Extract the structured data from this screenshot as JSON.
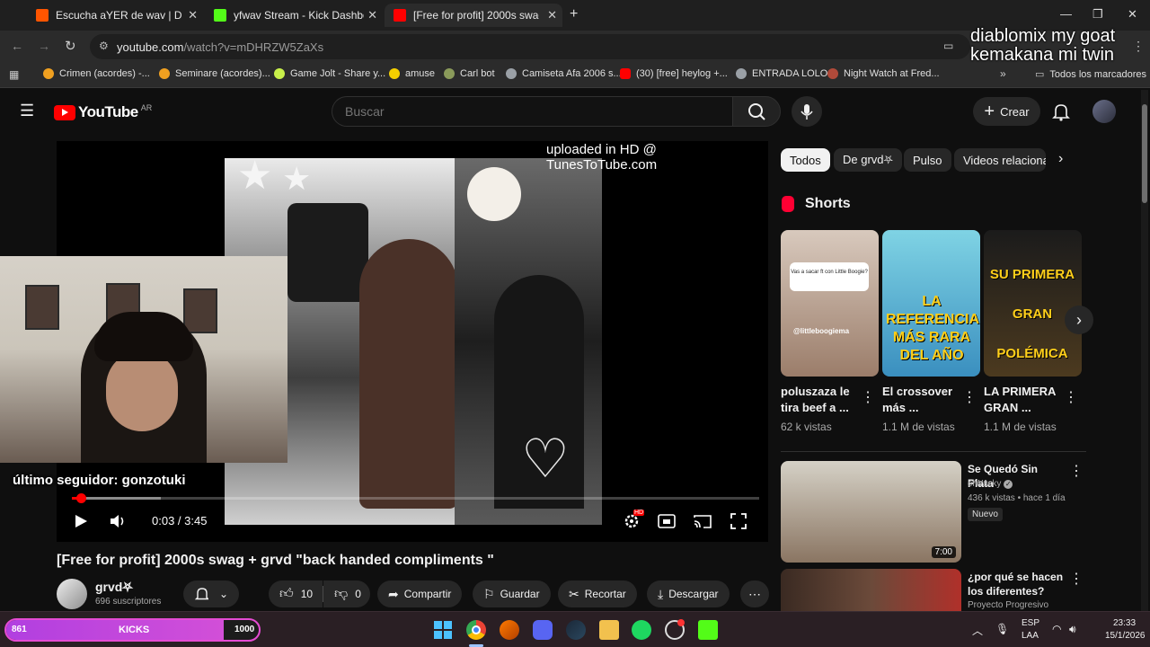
{
  "browser": {
    "tabs": [
      {
        "title": "Escucha aYER de wav | Disfruta",
        "color": "#ff5500"
      },
      {
        "title": "yfwav Stream - Kick Dashboard",
        "color": "#53fc18"
      },
      {
        "title": "[Free for profit] 2000s swag + g",
        "color": "#ff0000"
      }
    ],
    "url_host": "youtube.com",
    "url_path": "/watch?v=mDHRZW5ZaXs",
    "bookmarks": [
      "Crimen (acordes) -...",
      "Seminare (acordes)...",
      "Game Jolt - Share y...",
      "amuse",
      "Carl bot",
      "Camiseta Afa 2006 s...",
      "(30) [free] heylog +...",
      "ENTRADA LOLO",
      "Night Watch at Fred..."
    ],
    "all_bookmarks": "Todos los marcadores"
  },
  "overlay": {
    "line1": "diablomix my goat",
    "line2": "kemakana mi twin",
    "follower": "último seguidor: gonzotuki"
  },
  "youtube": {
    "logo": "YouTube",
    "region": "AR",
    "search_placeholder": "Buscar",
    "create_label": "Crear"
  },
  "player": {
    "watermark": "uploaded in HD @ TunesToTube.com",
    "current_time": "0:03",
    "duration": "3:45",
    "time_display": "0:03 / 3:45",
    "progress_fraction": 0.013,
    "buffer_fraction": 0.13
  },
  "video": {
    "title": "[Free for profit] 2000s swag + grvd \"back handed compliments \"",
    "channel": "grvd",
    "channel_suffix": "⛧",
    "subscribers": "696 suscriptores",
    "likes": "10",
    "dislikes": "0",
    "share_label": "Compartir",
    "save_label": "Guardar",
    "clip_label": "Recortar",
    "download_label": "Descargar"
  },
  "filters": [
    "Todos",
    "De grvd⛧",
    "Pulso",
    "Videos relaciona"
  ],
  "shorts": {
    "heading": "Shorts",
    "items": [
      {
        "title": "poluszaza le tira beef a ...",
        "views": "62 k vistas",
        "caption": "@littleboogiema",
        "question": "Vas a sacar ft con Little Boogie?"
      },
      {
        "title": "El crossover más ...",
        "views": "1.1 M de vistas",
        "caption": "LA REFERENCIA MÁS RARA DEL AÑO"
      },
      {
        "title": "LA PRIMERA GRAN ...",
        "views": "1.1 M de vistas",
        "caption": "SU PRIMERA GRAN POLÉMICA"
      }
    ]
  },
  "related": [
    {
      "title": "Se Quedó Sin Plata",
      "channel": "elWacky",
      "meta": "436 k vistas • hace 1 día",
      "badge": "Nuevo",
      "duration": "7:00"
    },
    {
      "title": "¿por qué se hacen los diferentes?",
      "channel": "Proyecto Progresivo"
    }
  ],
  "taskbar": {
    "kicks_left": "861",
    "kicks_label": "KICKS",
    "kicks_right": "1000",
    "kicks_fraction": 0.861,
    "lang": "ESP",
    "lang_sub": "LAA",
    "time": "23:33",
    "date": "15/1/2026"
  }
}
